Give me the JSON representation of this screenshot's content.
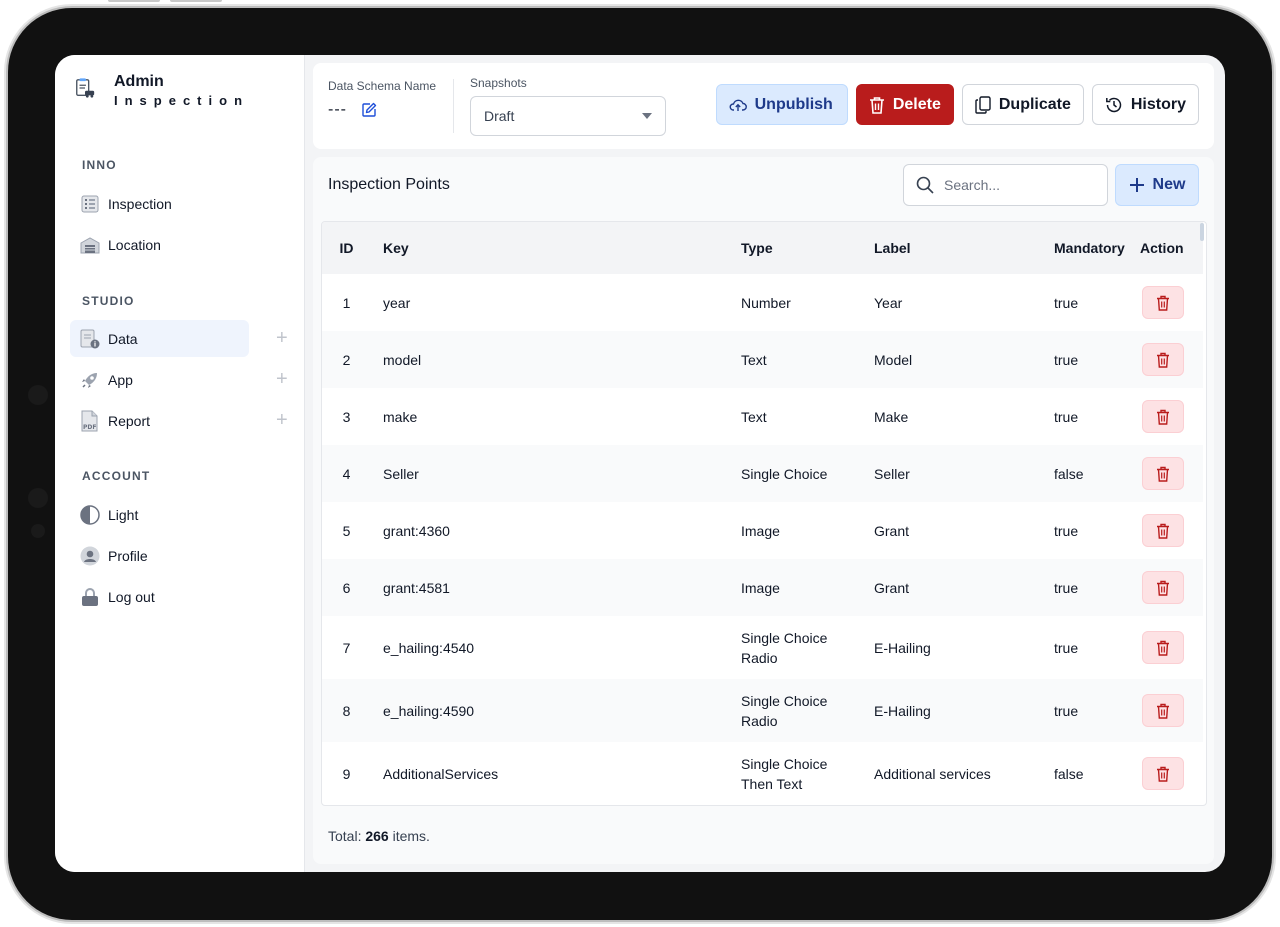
{
  "brand": {
    "title": "Admin",
    "subtitle": "Inspection"
  },
  "sidebar": {
    "sections": [
      {
        "label": "INNO",
        "items": [
          {
            "label": "Inspection",
            "icon": "list-icon"
          },
          {
            "label": "Location",
            "icon": "garage-icon"
          }
        ]
      },
      {
        "label": "STUDIO",
        "items": [
          {
            "label": "Data",
            "icon": "data-icon",
            "active": true
          },
          {
            "label": "App",
            "icon": "rocket-icon"
          },
          {
            "label": "Report",
            "icon": "pdf-icon"
          }
        ]
      },
      {
        "label": "ACCOUNT",
        "items": [
          {
            "label": "Light",
            "icon": "contrast-icon"
          },
          {
            "label": "Profile",
            "icon": "user-icon"
          },
          {
            "label": "Log out",
            "icon": "lock-icon"
          }
        ]
      }
    ]
  },
  "topbar": {
    "schema_label": "Data Schema Name",
    "schema_value": "---",
    "snapshots_label": "Snapshots",
    "snapshot_value": "Draft",
    "buttons": {
      "unpublish": "Unpublish",
      "delete": "Delete",
      "duplicate": "Duplicate",
      "history": "History"
    }
  },
  "panel": {
    "title": "Inspection Points",
    "search_placeholder": "Search...",
    "new_label": "New",
    "columns": [
      "ID",
      "Key",
      "Type",
      "Label",
      "Mandatory",
      "Action"
    ],
    "rows": [
      {
        "id": "1",
        "key": "year",
        "type": "Number",
        "type2": "",
        "label": "Year",
        "mandatory": "true"
      },
      {
        "id": "2",
        "key": "model",
        "type": "Text",
        "type2": "",
        "label": "Model",
        "mandatory": "true"
      },
      {
        "id": "3",
        "key": "make",
        "type": "Text",
        "type2": "",
        "label": "Make",
        "mandatory": "true"
      },
      {
        "id": "4",
        "key": "Seller",
        "type": "Single Choice",
        "type2": "",
        "label": "Seller",
        "mandatory": "false"
      },
      {
        "id": "5",
        "key": "grant:4360",
        "type": "Image",
        "type2": "",
        "label": "Grant",
        "mandatory": "true"
      },
      {
        "id": "6",
        "key": "grant:4581",
        "type": "Image",
        "type2": "",
        "label": "Grant",
        "mandatory": "true"
      },
      {
        "id": "7",
        "key": "e_hailing:4540",
        "type": "Single Choice",
        "type2": "Radio",
        "label": "E-Hailing",
        "mandatory": "true"
      },
      {
        "id": "8",
        "key": "e_hailing:4590",
        "type": "Single Choice",
        "type2": "Radio",
        "label": "E-Hailing",
        "mandatory": "true"
      },
      {
        "id": "9",
        "key": "AdditionalServices",
        "type": "Single Choice",
        "type2": "Then Text",
        "label": "Additional services",
        "mandatory": "false"
      }
    ],
    "total_prefix": "Total:",
    "total_count": "266",
    "total_suffix": "items."
  },
  "colors": {
    "danger": "#b91c1c",
    "primary_soft": "#dbeafe",
    "primary_text": "#1e3a8a"
  }
}
